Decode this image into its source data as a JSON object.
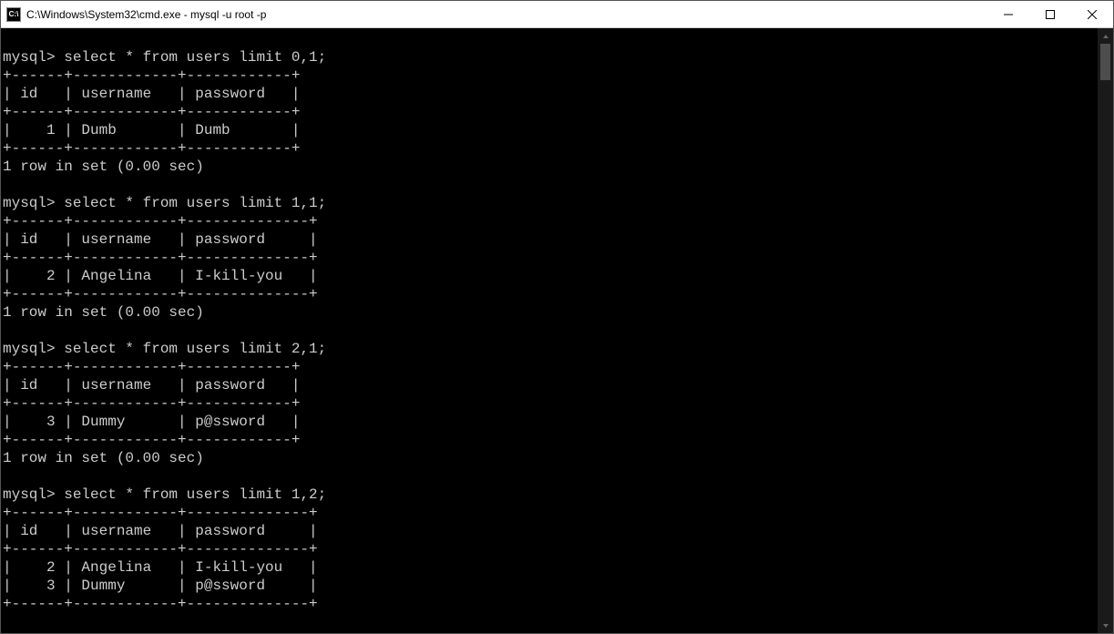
{
  "window": {
    "icon_label": "C:\\",
    "title": "C:\\Windows\\System32\\cmd.exe - mysql  -u root -p"
  },
  "prompt": "mysql>",
  "blocks": [
    {
      "command": "select * from users limit 0,1;",
      "cols": [
        "id",
        "username",
        "password"
      ],
      "widths": [
        4,
        10,
        10
      ],
      "rows": [
        {
          "id": "1",
          "username": "Dumb",
          "password": "Dumb"
        }
      ],
      "status": "1 row in set (0.00 sec)"
    },
    {
      "command": "select * from users limit 1,1;",
      "cols": [
        "id",
        "username",
        "password"
      ],
      "widths": [
        4,
        10,
        12
      ],
      "rows": [
        {
          "id": "2",
          "username": "Angelina",
          "password": "I-kill-you"
        }
      ],
      "status": "1 row in set (0.00 sec)"
    },
    {
      "command": "select * from users limit 2,1;",
      "cols": [
        "id",
        "username",
        "password"
      ],
      "widths": [
        4,
        10,
        10
      ],
      "rows": [
        {
          "id": "3",
          "username": "Dummy",
          "password": "p@ssword"
        }
      ],
      "status": "1 row in set (0.00 sec)"
    },
    {
      "command": "select * from users limit 1,2;",
      "cols": [
        "id",
        "username",
        "password"
      ],
      "widths": [
        4,
        10,
        12
      ],
      "rows": [
        {
          "id": "2",
          "username": "Angelina",
          "password": "I-kill-you"
        },
        {
          "id": "3",
          "username": "Dummy",
          "password": "p@ssword"
        }
      ],
      "status": null
    }
  ]
}
